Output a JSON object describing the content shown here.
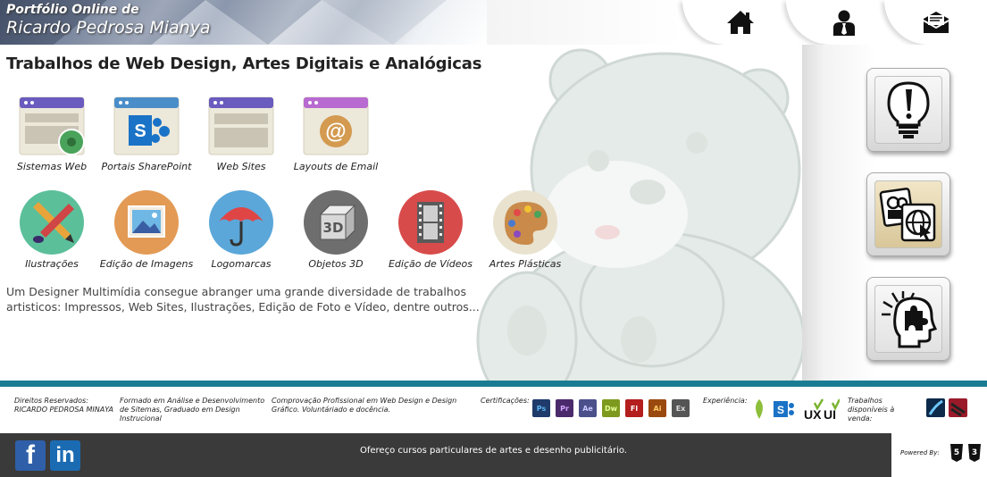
{
  "header": {
    "logo_line1": "Portfólio Online de",
    "logo_line2": "Ricardo Pedrosa Mianya",
    "nav": [
      {
        "icon": "home-icon"
      },
      {
        "icon": "user-suit-icon"
      },
      {
        "icon": "mail-icon"
      }
    ]
  },
  "main": {
    "title": "Trabalhos de Web Design, Artes Digitais e Analógicas",
    "row1": [
      {
        "label": "Sistemas Web",
        "icon": "web-system-gear-icon"
      },
      {
        "label": "Portais SharePoint",
        "icon": "sharepoint-icon"
      },
      {
        "label": "Web Sites",
        "icon": "website-window-icon"
      },
      {
        "label": "Layouts de Email",
        "icon": "email-at-icon"
      }
    ],
    "row2": [
      {
        "label": "Ilustrações",
        "icon": "pencil-brush-icon"
      },
      {
        "label": "Edição de Imagens",
        "icon": "picture-icon"
      },
      {
        "label": "Logomarcas",
        "icon": "umbrella-icon"
      },
      {
        "label": "Objetos 3D",
        "icon": "3d-cube-icon"
      },
      {
        "label": "Edição de Vídeos",
        "icon": "film-strip-icon"
      },
      {
        "label": "Artes Plásticas",
        "icon": "paint-palette-icon"
      }
    ],
    "description": "Um Designer Multimídia consegue abranger uma grande diversidade de trabalhos artisticos: Impressos, Web Sites, Ilustrações, Edição de Foto e Vídeo, dentre outros..."
  },
  "sidebar": {
    "buttons": [
      {
        "icon": "lightbulb-exclamation-icon"
      },
      {
        "icon": "media-web-icon"
      },
      {
        "icon": "head-puzzle-icon"
      }
    ]
  },
  "info": {
    "rights_label": "Direitos Reservados:",
    "rights_name": "RICARDO PEDROSA MINAYA",
    "education": "Formado em Análise e Desenvolvimento de Sitemas, Graduado em Design Instrucional",
    "proof": "Comprovação Profissional em Web Design e Design Gráfico. Voluntáriado e docência.",
    "certs_label": "Certificações:",
    "certs": [
      {
        "text": "Ps",
        "color": "#1f3b6b",
        "fg": "#5ab4f0"
      },
      {
        "text": "Pr",
        "color": "#4a2a6b",
        "fg": "#d3a6ff"
      },
      {
        "text": "Ae",
        "color": "#4b4f8a",
        "fg": "#c9c9ff"
      },
      {
        "text": "Dw",
        "color": "#7d9a1f",
        "fg": "#e9ff9a"
      },
      {
        "text": "Fl",
        "color": "#b41e1e",
        "fg": "#ffffff"
      },
      {
        "text": "Ai",
        "color": "#9a4a0f",
        "fg": "#ffcc66"
      },
      {
        "text": "Ex",
        "color": "#555555",
        "fg": "#dddddd"
      }
    ],
    "experience_label": "Experiência:",
    "for_sale_label": "Trabalhos disponíveis à venda:"
  },
  "footer": {
    "facebook": "f",
    "linkedin": "in",
    "text": "Ofereço cursos particulares de artes e desenho publicitário.",
    "powered_by": "Powered By:",
    "tech": [
      "5",
      "3"
    ]
  }
}
